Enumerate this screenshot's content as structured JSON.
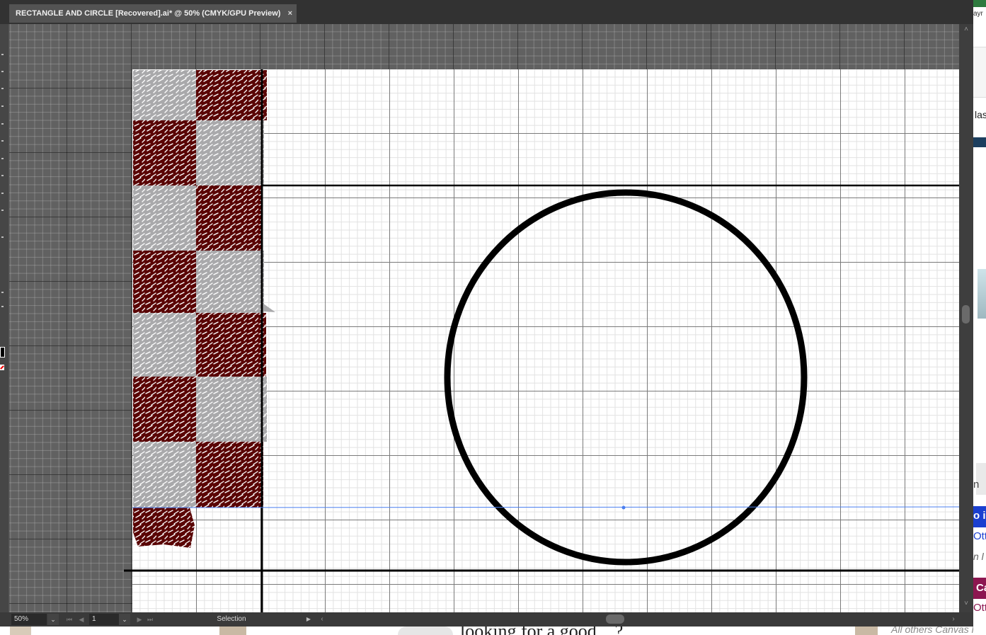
{
  "document_tab": {
    "title": "RECTANGLE AND CIRCLE [Recovered].ai* @ 50% (CMYK/GPU Preview)",
    "close_glyph": "×"
  },
  "statusbar": {
    "zoom": "50%",
    "artboard_number": "1",
    "status_text": "Selection",
    "dropdown_glyph": "⌄",
    "first_glyph": "⏮",
    "prev_glyph": "◀",
    "next_glyph": "▶",
    "last_glyph": "⏭",
    "menu_glyph": "▶",
    "scroll_left_glyph": "‹",
    "scroll_right_glyph": "›"
  },
  "vscroll": {
    "up_glyph": "˄",
    "down_glyph": "˅"
  },
  "background_window": {
    "right_fragments": [
      "ayr",
      "las",
      "n",
      "o i",
      "Ott",
      "n l",
      "Ca",
      "Ott"
    ],
    "bottom_fragments": [
      "looking for a good ...?",
      "All others Canvas l"
    ]
  },
  "colors": {
    "dark_tile": "#5a0505",
    "light_tile": "#a9a9ab",
    "circle_stroke": "#000000",
    "selection_blue": "#4a7ff0",
    "text_blue": "#1a3fd0",
    "text_magenta": "#8c1650"
  },
  "icons": {
    "stroke_swatch": "stroke-swatch-icon",
    "fill_none": "fill-none-icon"
  }
}
